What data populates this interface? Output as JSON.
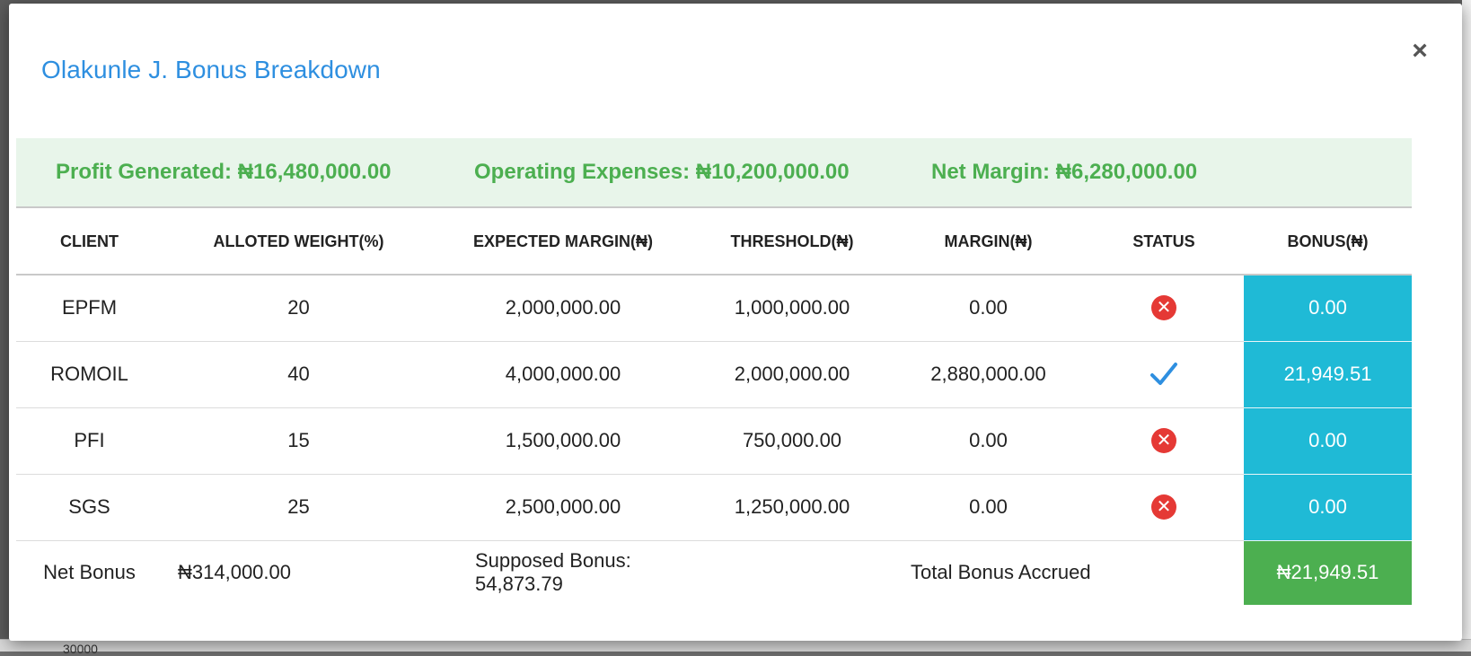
{
  "modal": {
    "title": "Olakunle J. Bonus Breakdown",
    "close_label": "×"
  },
  "summary": {
    "profit": "Profit Generated: ₦16,480,000.00",
    "expenses": "Operating Expenses: ₦10,200,000.00",
    "net_margin": "Net Margin: ₦6,280,000.00"
  },
  "table": {
    "headers": [
      "CLIENT",
      "ALLOTED WEIGHT(%)",
      "EXPECTED MARGIN(₦)",
      "THRESHOLD(₦)",
      "MARGIN(₦)",
      "STATUS",
      "BONUS(₦)"
    ],
    "rows": [
      {
        "client": "EPFM",
        "weight": "20",
        "expected": "2,000,000.00",
        "threshold": "1,000,000.00",
        "margin": "0.00",
        "status": "failed",
        "bonus": "0.00"
      },
      {
        "client": "ROMOIL",
        "weight": "40",
        "expected": "4,000,000.00",
        "threshold": "2,000,000.00",
        "margin": "2,880,000.00",
        "status": "passed",
        "bonus": "21,949.51"
      },
      {
        "client": "PFI",
        "weight": "15",
        "expected": "1,500,000.00",
        "threshold": "750,000.00",
        "margin": "0.00",
        "status": "failed",
        "bonus": "0.00"
      },
      {
        "client": "SGS",
        "weight": "25",
        "expected": "2,500,000.00",
        "threshold": "1,250,000.00",
        "margin": "0.00",
        "status": "failed",
        "bonus": "0.00"
      }
    ],
    "status_icons": {
      "failed": "x-circle-icon",
      "passed": "checkmark-icon"
    }
  },
  "footer": {
    "net_bonus_label": "Net Bonus",
    "net_bonus_value": "₦314,000.00",
    "supposed_bonus": "Supposed Bonus: 54,873.79",
    "total_label": "Total Bonus Accrued",
    "total_value": "₦21,949.51"
  },
  "background": {
    "partial_number": "30000"
  },
  "colors": {
    "title": "#2e8fe0",
    "summary_text": "#4caf50",
    "summary_bg": "#e8f5ea",
    "bonus_cell": "#1fbad6",
    "total_cell": "#4caf50",
    "failed": "#e53935",
    "passed": "#2e8fe0"
  }
}
